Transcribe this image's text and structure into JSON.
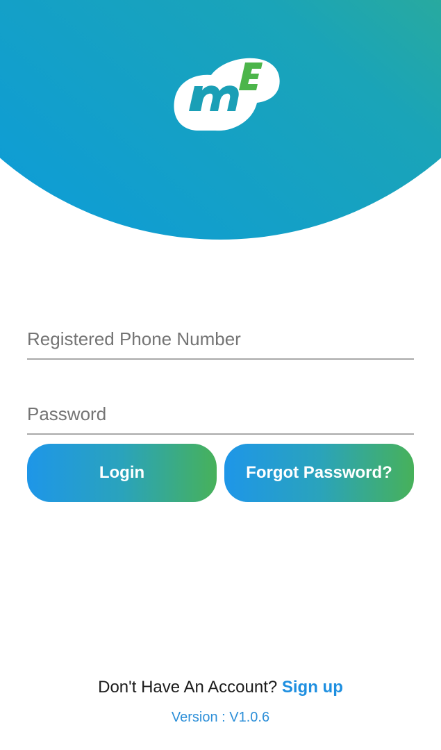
{
  "app": {
    "logo_text": "mE"
  },
  "form": {
    "phone_placeholder": "Registered Phone Number",
    "phone_value": "",
    "password_placeholder": "Password",
    "password_value": ""
  },
  "buttons": {
    "login_label": "Login",
    "forgot_label": "Forgot Password?"
  },
  "footer": {
    "signup_prompt": "Don't Have An Account? ",
    "signup_link": "Sign up",
    "version": "Version : V1.0.6"
  },
  "colors": {
    "brand_blue": "#0a9ae0",
    "brand_green": "#5ab96a",
    "link_blue": "#1e8fe0"
  },
  "icons": {
    "logo": "me-logo-icon"
  }
}
